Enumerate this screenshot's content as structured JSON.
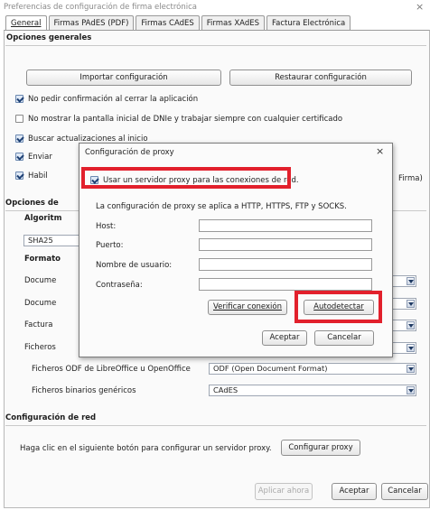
{
  "window": {
    "title": "Preferencias de configuración de firma electrónica",
    "close": "×"
  },
  "tabs": [
    "General",
    "Firmas PAdES (PDF)",
    "Firmas CAdES",
    "Firmas XAdES",
    "Factura Electrónica"
  ],
  "general": {
    "group_title": "Opciones generales",
    "import_button": "Importar configuración",
    "restore_button": "Restaurar configuración",
    "checkboxes": [
      {
        "label": "No pedir confirmación al cerrar la aplicación",
        "checked": true
      },
      {
        "label": "No mostrar la pantalla inicial de DNIe y trabajar siempre con cualquier certificado",
        "checked": false
      },
      {
        "label": "Buscar actualizaciones al inicio",
        "checked": true
      },
      {
        "label": "Enviar",
        "checked": true
      },
      {
        "label": "Habil",
        "checked": true
      }
    ],
    "partial_right_text": "Firma)"
  },
  "sign_options": {
    "group_title": "Opciones de",
    "algorithm_label": "Algoritm",
    "algorithm_value": "SHA25",
    "formats_label": "Formato",
    "rows": [
      {
        "label": "Docume",
        "value": ""
      },
      {
        "label": "Docume",
        "value": ""
      },
      {
        "label": "Factura",
        "value": ""
      },
      {
        "label": "Ficheros",
        "value": ""
      },
      {
        "label": "Ficheros ODF de LibreOffice u OpenOffice",
        "value": "ODF (Open Document Format)"
      },
      {
        "label": "Ficheros binarios genéricos",
        "value": "CAdES"
      }
    ]
  },
  "network": {
    "group_title": "Configuración de red",
    "text": "Haga clic en el siguiente botón para configurar un servidor proxy.",
    "button": "Configurar proxy"
  },
  "footer": {
    "apply": "Aplicar ahora",
    "accept": "Aceptar",
    "cancel": "Cancelar"
  },
  "proxy_dialog": {
    "title": "Configuración de proxy",
    "close": "×",
    "use_proxy_label": "Usar un servidor proxy para las conexiones de red.",
    "use_proxy_checked": true,
    "info": "La configuración de proxy se aplica a HTTP, HTTPS, FTP y SOCKS.",
    "fields": [
      {
        "label": "Host:",
        "value": ""
      },
      {
        "label": "Puerto:",
        "value": ""
      },
      {
        "label": "Nombre de usuario:",
        "value": ""
      },
      {
        "label": "Contraseña:",
        "value": ""
      }
    ],
    "verify_button": "Verificar conexión",
    "autodetect_button": "Autodetectar",
    "accept_button": "Aceptar",
    "cancel_button": "Cancelar"
  },
  "colors": {
    "highlight": "#e2202c",
    "checkbox_fill": "#dfe9f6",
    "combo_arrow": "#1f3a63"
  }
}
